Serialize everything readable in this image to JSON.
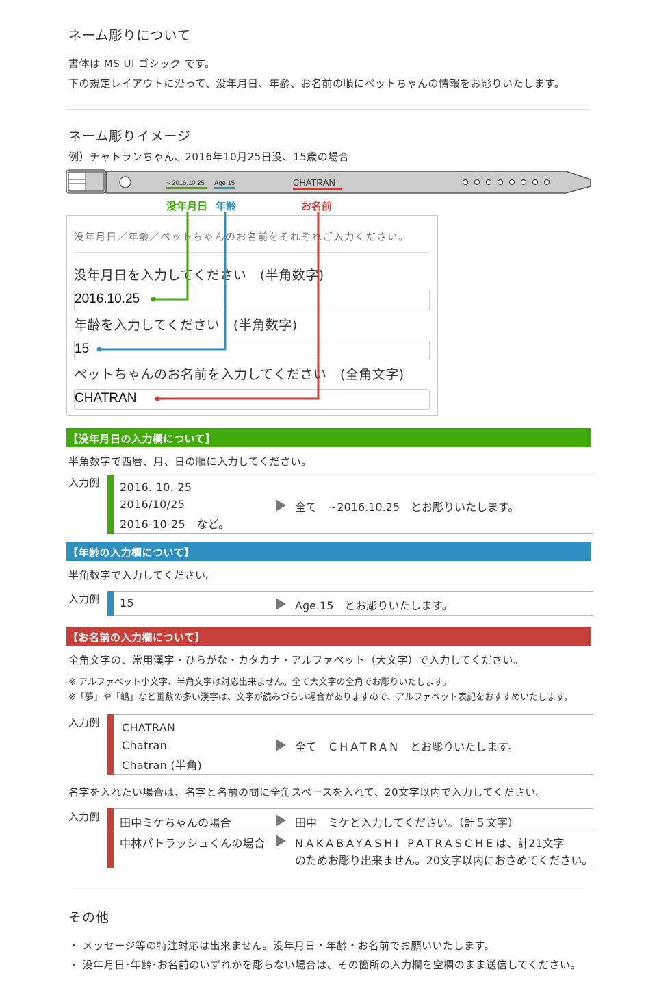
{
  "colors": {
    "green": "#3faa0a",
    "blue": "#2e90c0",
    "red": "#c8403a",
    "belt_fill": "#cccccc",
    "arrow": "#777777"
  },
  "about": {
    "title": "ネーム彫りについて",
    "font_line": "書体は  MS UI ゴシック です。",
    "layout_line": "下の規定レイアウトに沿って、没年月日、年齢、お名前の順にペットちゃんの情報をお彫りいたします。"
  },
  "image_section": {
    "title": "ネーム彫りイメージ",
    "example": "例）チャトランちゃん、2016年10月25日没、15歳の場合",
    "belt": {
      "date_text": "~ 2016.10.25",
      "age_text": "Age.15",
      "name_text": "CHATRAN",
      "hole_count": 8
    },
    "legend": {
      "date": "没年月日",
      "age": "年齢",
      "name": "お名前"
    },
    "form": {
      "intro": "没年月日／年齢／ペットちゃんのお名前をそれぞれご入力ください。",
      "date_label": "没年月日を入力してください　(半角数字)",
      "date_value": "2016.10.25",
      "age_label": "年齢を入力してください　(半角数字)",
      "age_value": "15",
      "name_label": "ペットちゃんのお名前を入力してください　(全角文字)",
      "name_value": "CHATRAN"
    }
  },
  "date_section": {
    "header": "【没年月日の入力欄について】",
    "desc": "半角数字で西暦、月、日の順に入力してください。",
    "example_label": "入力例",
    "inputs": [
      "2016. 10. 25",
      "2016/10/25",
      "2016-10-25　など。"
    ],
    "result": "全て　~2016.10.25　とお彫りいたします。"
  },
  "age_section": {
    "header": "【年齢の入力欄について】",
    "desc": "半角数字で入力してください。",
    "example_label": "入力例",
    "input": "15",
    "result": "Age.15　とお彫りいたします。"
  },
  "name_section": {
    "header": "【お名前の入力欄について】",
    "desc": "全角文字の、常用漢字・ひらがな・カタカナ・アルファベット（大文字）で入力してください。",
    "note1": "※ アルファベット小文字、半角文字は対応出来ません。全て大文字の全角でお彫りいたします。",
    "note2": "※「夢」や「嶋」など画数の多い漢字は、文字が読みづらい場合がありますので、アルファベット表記をおすすめいたします。",
    "example_label": "入力例",
    "inputs": [
      "CHATRAN",
      "Chatran",
      "Chatran (半角)"
    ],
    "result_prefix": "全て",
    "result_name": "CHATRAN",
    "result_suffix": "とお彫りいたします。",
    "surname_note": "名字を入れたい場合は、名字と名前の間に全角スペースを入れて、20文字以内で入力してください。",
    "surname_example_label": "入力例",
    "surname_rows": [
      {
        "case": "田中ミケちゃんの場合",
        "result": "田中　ミケと入力してください。（計５文字）"
      },
      {
        "case": "中林パトラッシュくんの場合",
        "result_line1_name": "NAKABAYASHI PATRASCHE",
        "result_line1_suffix": "は、計21文字",
        "result_line2": "のためお彫り出来ません。20文字以内におさめてください。"
      }
    ]
  },
  "other": {
    "title": "その他",
    "items": [
      "・ メッセージ等の特注対応は出来ません。没年月日・年齢・お名前でお願いいたします。",
      "・ 没年月日･年齢･お名前のいずれかを彫らない場合は、その箇所の入力欄を空欄のまま送信してください。"
    ]
  }
}
